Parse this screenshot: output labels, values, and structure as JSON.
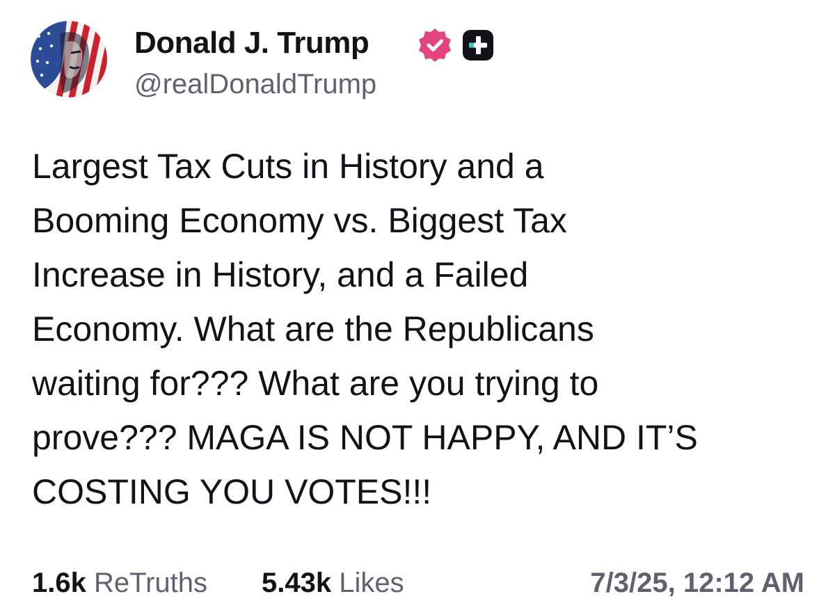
{
  "author": {
    "display_name": "Donald J. Trump",
    "handle": "@realDonaldTrump",
    "verified_icon": "verified-badge-icon",
    "plus_icon": "truth-plus-icon",
    "verified_color": "#e5457f"
  },
  "post": {
    "lines": [
      "Largest Tax Cuts in History and a",
      "Booming Economy vs. Biggest Tax",
      "Increase in History, and a Failed",
      "Economy. What are the Republicans",
      "waiting for??? What are you trying to",
      "prove??? MAGA IS NOT HAPPY, AND IT’S",
      "COSTING YOU VOTES!!!"
    ]
  },
  "stats": {
    "retruths_count": "1.6k",
    "retruths_label": "ReTruths",
    "likes_count": "5.43k",
    "likes_label": "Likes"
  },
  "timestamp": "7/3/25, 12:12 AM"
}
